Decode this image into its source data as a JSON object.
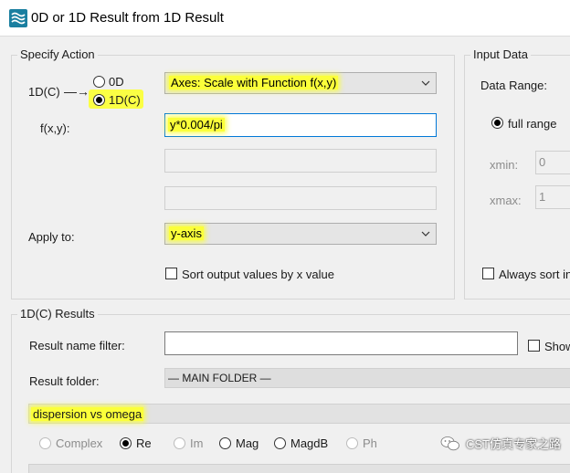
{
  "window": {
    "title": "0D or 1D Result from 1D Result",
    "icon": "signal-waves-icon",
    "accent": "#1a7fa0"
  },
  "specify_action": {
    "legend": "Specify Action",
    "mode_label": "1D(C)",
    "arrow": "—→",
    "radio_0d": "0D",
    "radio_1dc": "1D(C)",
    "action_value": "Axes: Scale with Function f(x,y)",
    "fxy_label": "f(x,y):",
    "fxy_value": "y*0.004/pi",
    "apply_label": "Apply to:",
    "apply_value": "y-axis",
    "sort_label": "Sort output values by x value"
  },
  "input_data": {
    "legend": "Input Data",
    "range_label": "Data Range:",
    "full_range_label": "full range",
    "xmin_label": "xmin:",
    "xmin_value": "0",
    "xmax_label": "xmax:",
    "xmax_value": "1",
    "always_sort_label": "Always sort in"
  },
  "results": {
    "legend": "1D(C) Results",
    "filter_label": "Result name filter:",
    "filter_value": "",
    "show_label": "Show",
    "folder_label": "Result folder:",
    "folder_value": "— MAIN FOLDER —",
    "selected_result": "dispersion vs omega",
    "complex_options": [
      "Complex",
      "Re",
      "Im",
      "Mag",
      "MagdB",
      "Ph"
    ],
    "complex_selected": "Re"
  },
  "watermark": {
    "text": "CST仿真专家之路",
    "icon": "wechat-icon"
  },
  "colors": {
    "highlight": "#fbff3a",
    "focus": "#0078d7"
  }
}
